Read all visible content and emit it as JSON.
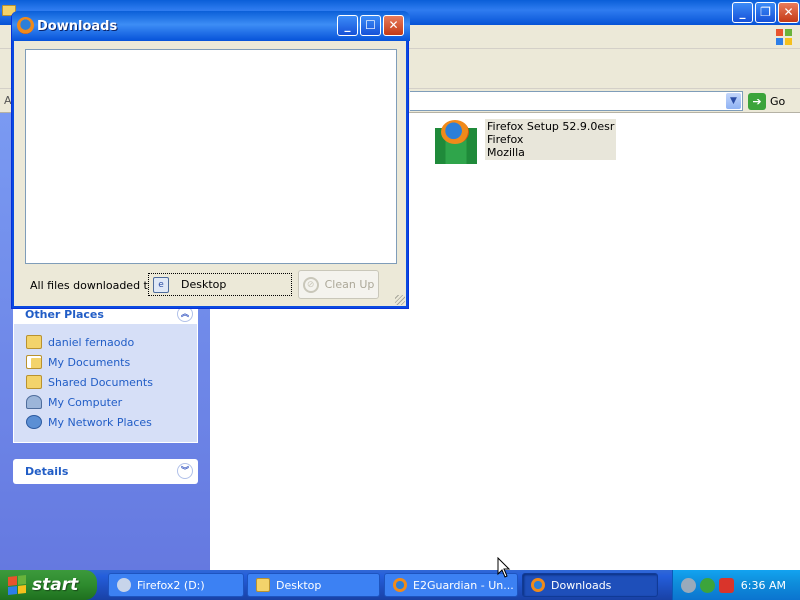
{
  "explorer": {
    "address_label": "A",
    "go_label": "Go",
    "file": {
      "name": "Firefox Setup 52.9.0esr",
      "line2": "Firefox",
      "line3": "Mozilla"
    },
    "other_places": {
      "title": "Other Places",
      "items": [
        {
          "label": "daniel fernaodo",
          "icon": "folder-icon"
        },
        {
          "label": "My Documents",
          "icon": "my-documents-icon"
        },
        {
          "label": "Shared Documents",
          "icon": "folder-icon"
        },
        {
          "label": "My Computer",
          "icon": "my-computer-icon"
        },
        {
          "label": "My Network Places",
          "icon": "network-places-icon"
        }
      ]
    },
    "details": {
      "title": "Details"
    }
  },
  "downloads_window": {
    "title": "Downloads",
    "footer_label": "All files downloaded to:",
    "folder": "Desktop",
    "cleanup_label": "Clean Up"
  },
  "taskbar": {
    "start_label": "start",
    "tasks": [
      {
        "label": "Firefox2 (D:)"
      },
      {
        "label": "Desktop"
      },
      {
        "label": "E2Guardian - Un..."
      },
      {
        "label": "Downloads"
      }
    ],
    "clock": "6:36 AM"
  },
  "colors": {
    "xp_title_blue": "#0a5fd8",
    "explorer_pane_blue": "#6579e0",
    "start_green": "#2e8b2e",
    "tray_blue": "#0f8fdc"
  }
}
